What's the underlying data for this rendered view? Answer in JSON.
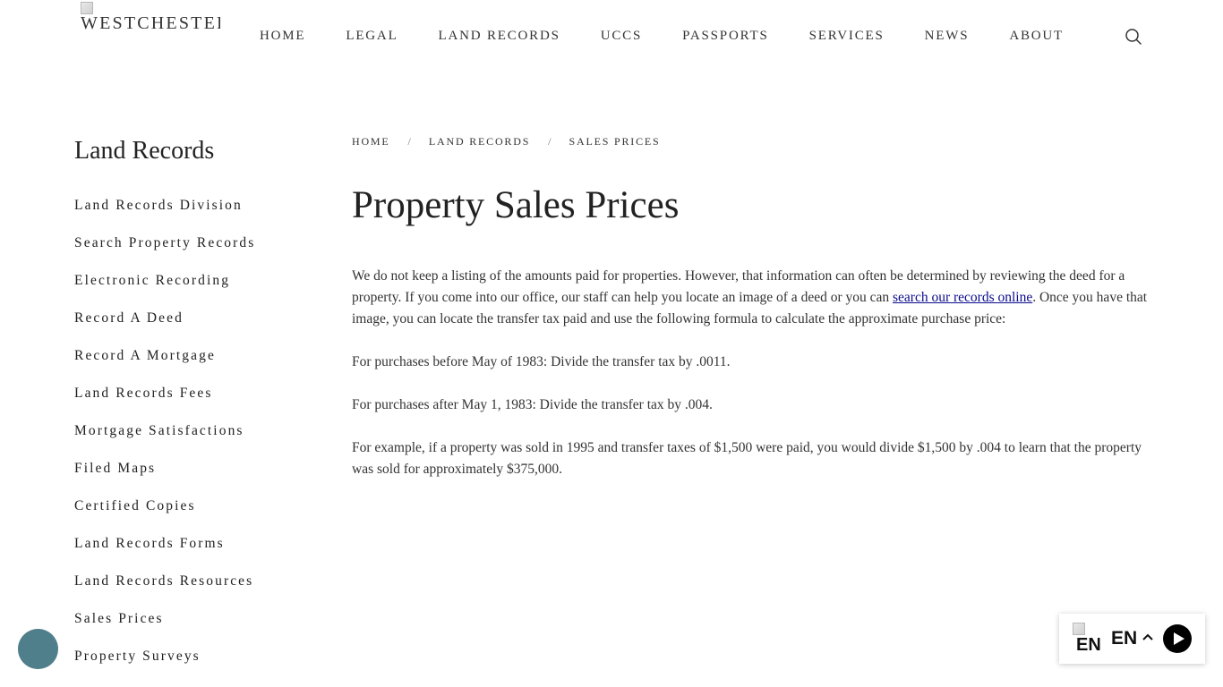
{
  "header": {
    "logo_text": "WESTCHESTER COUNTY",
    "nav": [
      {
        "label": "HOME"
      },
      {
        "label": "LEGAL"
      },
      {
        "label": "LAND RECORDS"
      },
      {
        "label": "UCCS"
      },
      {
        "label": "PASSPORTS"
      },
      {
        "label": "SERVICES"
      },
      {
        "label": "NEWS"
      },
      {
        "label": "ABOUT"
      }
    ],
    "search_icon": "search-icon"
  },
  "sidebar": {
    "title": "Land Records",
    "items": [
      {
        "label": "Land Records Division"
      },
      {
        "label": "Search Property Records"
      },
      {
        "label": "Electronic Recording"
      },
      {
        "label": "Record A Deed"
      },
      {
        "label": "Record A Mortgage"
      },
      {
        "label": "Land Records Fees"
      },
      {
        "label": "Mortgage Satisfactions"
      },
      {
        "label": "Filed Maps"
      },
      {
        "label": "Certified Copies"
      },
      {
        "label": "Land Records Forms"
      },
      {
        "label": "Land Records Resources"
      },
      {
        "label": "Sales Prices"
      },
      {
        "label": "Property Surveys"
      }
    ]
  },
  "breadcrumb": {
    "items": [
      {
        "label": "HOME"
      },
      {
        "label": "LAND RECORDS"
      },
      {
        "label": "SALES PRICES"
      }
    ],
    "separator": "/"
  },
  "main": {
    "title": "Property Sales Prices",
    "para1_before": "We do not keep a listing of the amounts paid for properties. However, that information can often be determined by reviewing the deed for a property. If you come into our office, our staff can help you locate an image of a deed or you can ",
    "para1_link": "search our records online",
    "para1_after": ". Once you have that image, you can locate the transfer tax paid and use the following formula to calculate the approximate purchase price:",
    "para2": "For purchases before May of 1983: Divide the transfer tax by .0011.",
    "para3": "For purchases after May 1, 1983: Divide the transfer tax by .004.",
    "para4": "For example, if a property was sold in 1995 and transfer taxes of $1,500 were paid, you would divide $1,500 by .004 to learn that the property was sold for approximately $375,000."
  },
  "widgets": {
    "lang_flag_alt": "EN",
    "lang_code": "EN",
    "chat_icon": "chat-bubble-icon",
    "play_icon": "play-icon",
    "caret_icon": "chevron-up-icon",
    "chat_color": "#4f7f8a"
  }
}
